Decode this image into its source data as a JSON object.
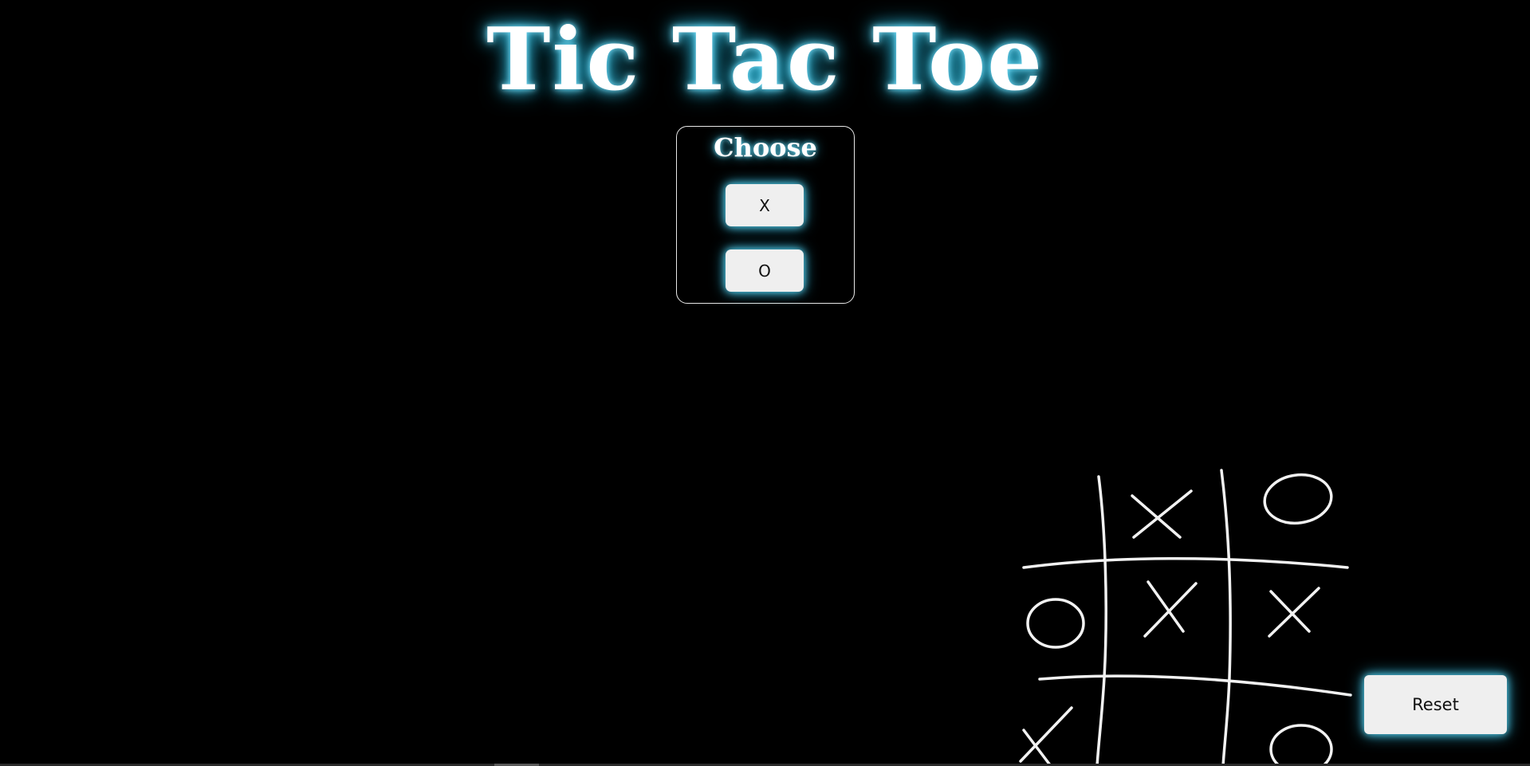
{
  "page": {
    "title": "Tic Tac Toe",
    "accent_glow": "#3cc4e6",
    "background": "#000000"
  },
  "chooser": {
    "heading": "Choose",
    "option_x": "X",
    "option_o": "O"
  },
  "board_art": {
    "icon": "hand-drawn-tic-tac-toe-board-icon",
    "cells": [
      "",
      "X",
      "O",
      "O",
      "X",
      "X",
      "X",
      "",
      "O"
    ]
  },
  "controls": {
    "reset_label": "Reset"
  }
}
